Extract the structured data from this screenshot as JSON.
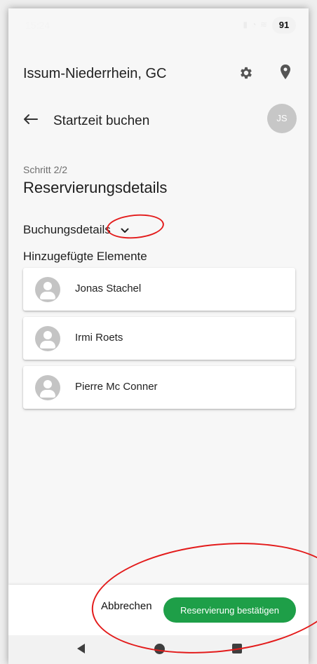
{
  "status_bar": {
    "time": "15:24",
    "icons": "▮ ◔ ≋",
    "battery": "91"
  },
  "app_bar": {
    "club_name": "Issum-Niederrhein, GC",
    "settings_icon": "gear-icon",
    "location_icon": "map-pin-icon"
  },
  "header": {
    "title": "Startzeit buchen",
    "user_initials": "JS"
  },
  "step": {
    "label": "Schritt 2/2",
    "title": "Reservierungsdetails"
  },
  "booking_details": {
    "label": "Buchungsdetails"
  },
  "added_elements": {
    "label": "Hinzugefügte Elemente",
    "players": [
      {
        "name": "Jonas Stachel"
      },
      {
        "name": "Irmi Roets"
      },
      {
        "name": "Pierre Mc Conner"
      }
    ]
  },
  "actions": {
    "cancel_label": "Abbrechen",
    "confirm_label": "Reservierung bestätigen"
  },
  "colors": {
    "accent": "#1e9f48",
    "annotation": "#e31b1b"
  }
}
